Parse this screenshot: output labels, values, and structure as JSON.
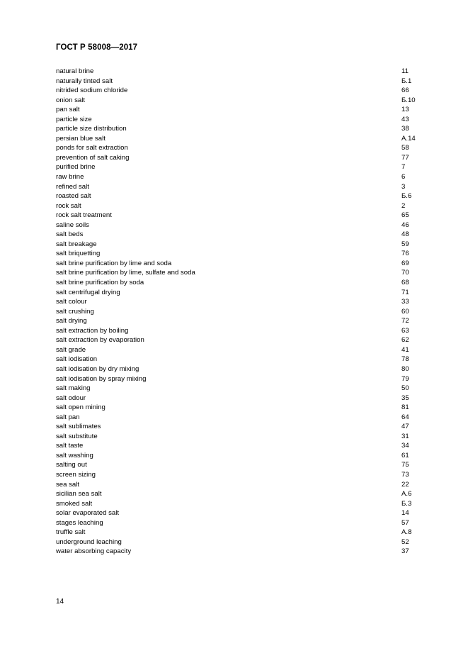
{
  "header": {
    "title": "ГОСТ Р 58008—2017"
  },
  "index": {
    "entries": [
      {
        "term": "natural brine",
        "ref": "11"
      },
      {
        "term": "naturally tinted salt",
        "ref": "Б.1"
      },
      {
        "term": "nitrided sodium chloride",
        "ref": "66"
      },
      {
        "term": "onion salt",
        "ref": "Б.10"
      },
      {
        "term": "pan salt",
        "ref": "13"
      },
      {
        "term": "particle size",
        "ref": "43"
      },
      {
        "term": "particle size distribution",
        "ref": "38"
      },
      {
        "term": "persian blue salt",
        "ref": "A.14"
      },
      {
        "term": "ponds for salt extraction",
        "ref": "58"
      },
      {
        "term": "prevention of salt caking",
        "ref": "77"
      },
      {
        "term": "purified brine",
        "ref": "7"
      },
      {
        "term": "raw brine",
        "ref": "6"
      },
      {
        "term": "refined salt",
        "ref": "3"
      },
      {
        "term": "roasted salt",
        "ref": "Б.6"
      },
      {
        "term": "rock salt",
        "ref": "2"
      },
      {
        "term": "rock salt treatment",
        "ref": "65"
      },
      {
        "term": "saline soils",
        "ref": "46"
      },
      {
        "term": "salt beds",
        "ref": "48"
      },
      {
        "term": "salt breakage",
        "ref": "59"
      },
      {
        "term": "salt briquetting",
        "ref": "76"
      },
      {
        "term": "salt brine purification by lime and soda",
        "ref": "69"
      },
      {
        "term": "salt brine purification by lime, sulfate and soda",
        "ref": "70"
      },
      {
        "term": "salt brine purification by soda",
        "ref": "68"
      },
      {
        "term": "salt centrifugal drying",
        "ref": "71"
      },
      {
        "term": "salt colour",
        "ref": "33"
      },
      {
        "term": "salt crushing",
        "ref": "60"
      },
      {
        "term": "salt drying",
        "ref": "72"
      },
      {
        "term": "salt extraction by boiling",
        "ref": "63"
      },
      {
        "term": "salt extraction by evaporation",
        "ref": "62"
      },
      {
        "term": "salt grade",
        "ref": "41"
      },
      {
        "term": "salt iodisation",
        "ref": "78"
      },
      {
        "term": "salt iodisation by dry mixing",
        "ref": "80"
      },
      {
        "term": "salt iodisation by spray mixing",
        "ref": "79"
      },
      {
        "term": "salt making",
        "ref": "50"
      },
      {
        "term": "salt odour",
        "ref": "35"
      },
      {
        "term": "salt open mining",
        "ref": "81"
      },
      {
        "term": "salt pan",
        "ref": "64"
      },
      {
        "term": "salt sublimates",
        "ref": "47"
      },
      {
        "term": "salt substitute",
        "ref": "31"
      },
      {
        "term": "salt taste",
        "ref": "34"
      },
      {
        "term": "salt washing",
        "ref": "61"
      },
      {
        "term": "salting out",
        "ref": "75"
      },
      {
        "term": "screen sizing",
        "ref": "73"
      },
      {
        "term": "sea salt",
        "ref": "22"
      },
      {
        "term": "sicilian sea salt",
        "ref": "A.6"
      },
      {
        "term": "smoked salt",
        "ref": "Б.3"
      },
      {
        "term": "solar evaporated salt",
        "ref": "14"
      },
      {
        "term": "stages leaching",
        "ref": "57"
      },
      {
        "term": "truffle salt",
        "ref": "A.8"
      },
      {
        "term": "underground leaching",
        "ref": "52"
      },
      {
        "term": "water absorbing capacity",
        "ref": "37"
      }
    ]
  },
  "footer": {
    "page_number": "14"
  }
}
